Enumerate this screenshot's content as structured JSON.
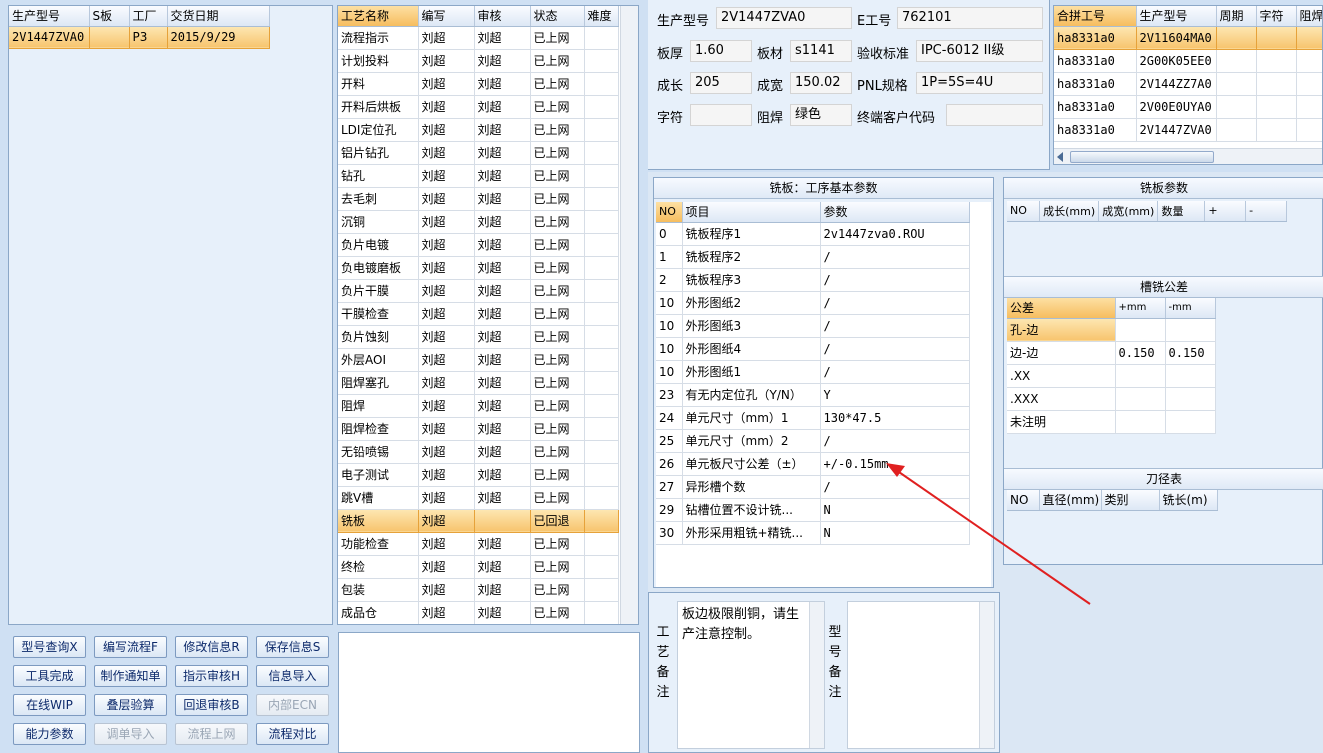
{
  "left_table": {
    "headers": [
      "生产型号",
      "S板",
      "工厂",
      "交货日期"
    ],
    "rows": [
      [
        "2V1447ZVA0",
        "",
        "P3",
        "2015/9/29"
      ]
    ]
  },
  "process_table": {
    "headers": [
      "工艺名称",
      "编写",
      "审核",
      "状态",
      "难度"
    ],
    "rows": [
      [
        "流程指示",
        "刘超",
        "刘超",
        "已上网",
        ""
      ],
      [
        "计划投料",
        "刘超",
        "刘超",
        "已上网",
        ""
      ],
      [
        "开料",
        "刘超",
        "刘超",
        "已上网",
        ""
      ],
      [
        "开料后烘板",
        "刘超",
        "刘超",
        "已上网",
        ""
      ],
      [
        "LDI定位孔",
        "刘超",
        "刘超",
        "已上网",
        ""
      ],
      [
        "铝片钻孔",
        "刘超",
        "刘超",
        "已上网",
        ""
      ],
      [
        "钻孔",
        "刘超",
        "刘超",
        "已上网",
        ""
      ],
      [
        "去毛刺",
        "刘超",
        "刘超",
        "已上网",
        ""
      ],
      [
        "沉铜",
        "刘超",
        "刘超",
        "已上网",
        ""
      ],
      [
        "负片电镀",
        "刘超",
        "刘超",
        "已上网",
        ""
      ],
      [
        "负电镀磨板",
        "刘超",
        "刘超",
        "已上网",
        ""
      ],
      [
        "负片干膜",
        "刘超",
        "刘超",
        "已上网",
        ""
      ],
      [
        "干膜检查",
        "刘超",
        "刘超",
        "已上网",
        ""
      ],
      [
        "负片蚀刻",
        "刘超",
        "刘超",
        "已上网",
        ""
      ],
      [
        "外层AOI",
        "刘超",
        "刘超",
        "已上网",
        ""
      ],
      [
        "阻焊塞孔",
        "刘超",
        "刘超",
        "已上网",
        ""
      ],
      [
        "阻焊",
        "刘超",
        "刘超",
        "已上网",
        ""
      ],
      [
        "阻焊检查",
        "刘超",
        "刘超",
        "已上网",
        ""
      ],
      [
        "无铅喷锡",
        "刘超",
        "刘超",
        "已上网",
        ""
      ],
      [
        "电子测试",
        "刘超",
        "刘超",
        "已上网",
        ""
      ],
      [
        "跳V槽",
        "刘超",
        "刘超",
        "已上网",
        ""
      ],
      [
        "铣板",
        "刘超",
        "",
        "已回退",
        ""
      ],
      [
        "功能检查",
        "刘超",
        "刘超",
        "已上网",
        ""
      ],
      [
        "终检",
        "刘超",
        "刘超",
        "已上网",
        ""
      ],
      [
        "包装",
        "刘超",
        "刘超",
        "已上网",
        ""
      ],
      [
        "成品仓",
        "刘超",
        "刘超",
        "已上网",
        ""
      ]
    ]
  },
  "buttons": [
    "型号查询X",
    "编写流程F",
    "修改信息R",
    "保存信息S",
    "工具完成",
    "制作通知单",
    "指示审核H",
    "信息导入",
    "在线WIP",
    "叠层验算",
    "回退审核B",
    "内部ECN",
    "能力参数",
    "调单导入",
    "流程上网",
    "流程对比"
  ],
  "info": {
    "model_label": "生产型号",
    "model_value": "2V1447ZVA0",
    "e_label": "E工号",
    "e_value": "762101",
    "thick_label": "板厚",
    "thick_value": "1.60",
    "mat_label": "板材",
    "mat_value": "s1141",
    "std_label": "验收标准",
    "std_value": "IPC-6012 II级",
    "len_label": "成长",
    "len_value": "205",
    "wid_label": "成宽",
    "wid_value": "150.02",
    "pnl_label": "PNL规格",
    "pnl_value": "1P=5S=4U",
    "char_label": "字符",
    "char_value": "",
    "mask_label": "阻焊",
    "mask_value": "绿色",
    "cust_label": "终端客户代码",
    "cust_value": ""
  },
  "combine_table": {
    "headers": [
      "合拼工号",
      "生产型号",
      "周期",
      "字符",
      "阻焊"
    ],
    "rows": [
      [
        "ha8331a0",
        "2V11604MA0",
        "",
        "",
        ""
      ],
      [
        "ha8331a0",
        "2G00K05EE0",
        "",
        "",
        ""
      ],
      [
        "ha8331a0",
        "2V144ZZ7A0",
        "",
        "",
        ""
      ],
      [
        "ha8331a0",
        "2V00E0UYA0",
        "",
        "",
        ""
      ],
      [
        "ha8331a0",
        "2V1447ZVA0",
        "",
        "",
        ""
      ]
    ]
  },
  "mill_params": {
    "title": "铣板：工序基本参数",
    "headers": [
      "NO",
      "项目",
      "参数"
    ],
    "rows": [
      [
        "0",
        "铣板程序1",
        "2v1447zva0.ROU"
      ],
      [
        "1",
        "铣板程序2",
        "/"
      ],
      [
        "2",
        "铣板程序3",
        "/"
      ],
      [
        "10",
        "外形图纸2",
        "/"
      ],
      [
        "10",
        "外形图纸3",
        "/"
      ],
      [
        "10",
        "外形图纸4",
        "/"
      ],
      [
        "10",
        "外形图纸1",
        "/"
      ],
      [
        "23",
        "有无内定位孔（Y/N）",
        "Y"
      ],
      [
        "24",
        "单元尺寸（mm）1",
        "130*47.5"
      ],
      [
        "25",
        "单元尺寸（mm）2",
        "/"
      ],
      [
        "26",
        "单元板尺寸公差（±）",
        "+/-0.15mm"
      ],
      [
        "27",
        "异形槽个数",
        "/"
      ],
      [
        "29",
        "钻槽位置不设计铣...",
        "N"
      ],
      [
        "30",
        "外形采用粗铣+精铣...",
        "N"
      ]
    ]
  },
  "mill_board": {
    "title": "铣板参数",
    "headers": [
      "NO",
      "成长(mm)",
      "成宽(mm)",
      "数量",
      "+",
      "-"
    ]
  },
  "slot_tol": {
    "title": "槽铣公差",
    "headers": [
      "公差",
      "+mm",
      "-mm"
    ],
    "rows": [
      [
        "孔-边",
        "",
        ""
      ],
      [
        "边-边",
        "0.150",
        "0.150"
      ],
      [
        ".XX",
        "",
        ""
      ],
      [
        ".XXX",
        "",
        ""
      ],
      [
        "未注明",
        "",
        ""
      ]
    ]
  },
  "tool_table": {
    "title": "刀径表",
    "headers": [
      "NO",
      "直径(mm)",
      "类别",
      "铣长(m)"
    ]
  },
  "remarks": {
    "process_label": "工艺备注",
    "process_text": "板边极限削铜，请生产注意控制。",
    "model_label": "型号备注",
    "model_text": ""
  },
  "colors": {
    "selection": "#f7c46e",
    "arrow": "#e02020",
    "panel": "#e7f0fa"
  }
}
